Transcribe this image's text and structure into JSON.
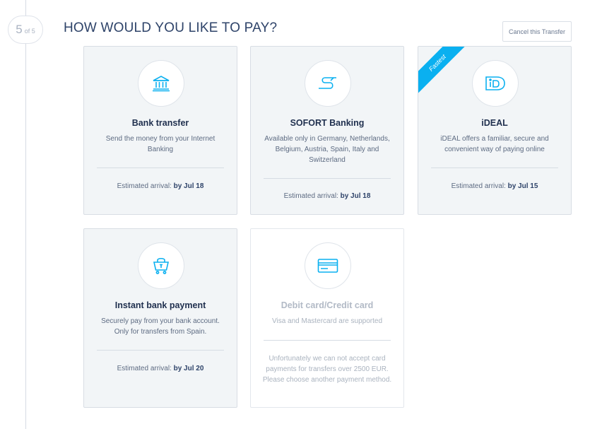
{
  "step": {
    "current": "5",
    "total_label": "of 5"
  },
  "page": {
    "title": "HOW WOULD YOU LIKE TO PAY?",
    "cancel_label": "Cancel this Transfer"
  },
  "methods": [
    {
      "title": "Bank transfer",
      "description": "Send the money from your Internet Banking",
      "arrival_label": "Estimated arrival:",
      "arrival_date": "by Jul 18",
      "icon": "bank-icon"
    },
    {
      "title": "SOFORT Banking",
      "description": "Available only in Germany, Netherlands, Belgium, Austria, Spain, Italy and Switzerland",
      "arrival_label": "Estimated arrival:",
      "arrival_date": "by Jul 18",
      "icon": "sofort-icon"
    },
    {
      "title": "iDEAL",
      "description": "iDEAL offers a familiar, secure and convenient way of paying online",
      "arrival_label": "Estimated arrival:",
      "arrival_date": "by Jul 15",
      "icon": "ideal-icon",
      "badge": "Fastest"
    },
    {
      "title": "Instant bank payment",
      "description": "Securely pay from your bank account. Only for transfers from Spain.",
      "arrival_label": "Estimated arrival:",
      "arrival_date": "by Jul 20",
      "icon": "shopping-basket-icon"
    },
    {
      "title": "Debit card/Credit card",
      "description": "Visa and Mastercard are supported",
      "warning": "Unfortunately we can not accept card payments for transfers over 2500 EUR. Please choose another payment method.",
      "icon": "credit-card-icon"
    }
  ],
  "colors": {
    "accent": "#0ab0f0",
    "text": "#2e4369",
    "card_bg": "#f2f5f7"
  }
}
